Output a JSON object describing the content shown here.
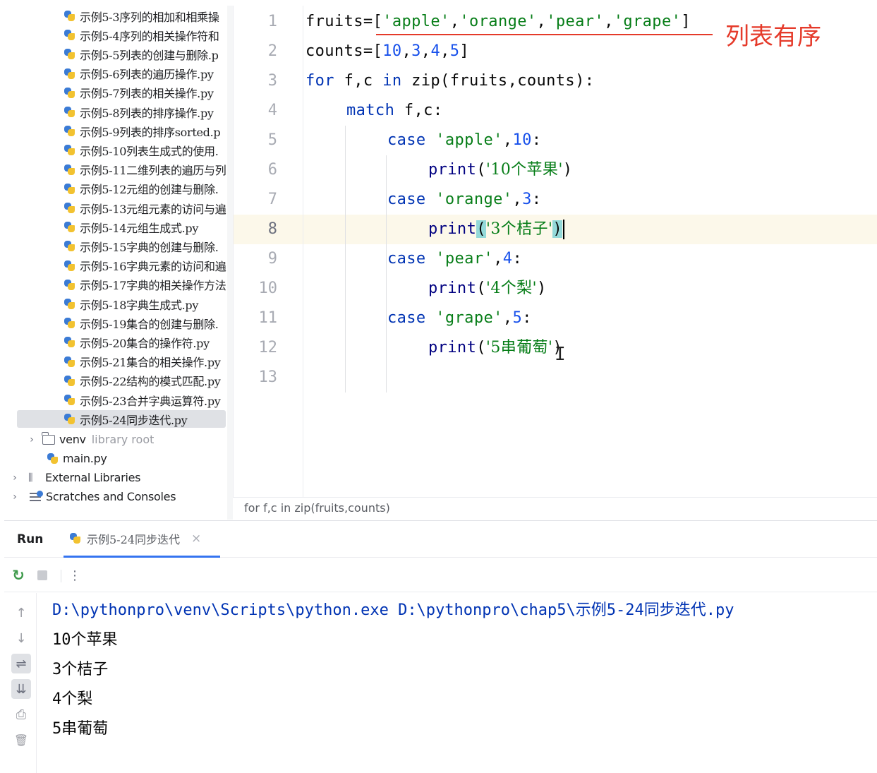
{
  "project_tree": {
    "files": [
      "示例5-3序列的相加和相乘操",
      "示例5-4序列的相关操作符和",
      "示例5-5列表的创建与删除.p",
      "示例5-6列表的遍历操作.py",
      "示例5-7列表的相关操作.py",
      "示例5-8列表的排序操作.py",
      "示例5-9列表的排序sorted.p",
      "示例5-10列表生成式的使用.",
      "示例5-11二维列表的遍历与列",
      "示例5-12元组的创建与删除.",
      "示例5-13元组元素的访问与遍",
      "示例5-14元组生成式.py",
      "示例5-15字典的创建与删除.",
      "示例5-16字典元素的访问和遍",
      "示例5-17字典的相关操作方法",
      "示例5-18字典生成式.py",
      "示例5-19集合的创建与删除.",
      "示例5-20集合的操作符.py",
      "示例5-21集合的相关操作.py",
      "示例5-22结构的模式匹配.py",
      "示例5-23合并字典运算符.py",
      "示例5-24同步迭代.py"
    ],
    "selected_index": 21,
    "venv_label": "venv",
    "venv_hint": "library root",
    "main_file": "main.py",
    "external_libraries": "External Libraries",
    "scratches": "Scratches and Consoles"
  },
  "editor": {
    "line_numbers": [
      "1",
      "2",
      "3",
      "4",
      "5",
      "6",
      "7",
      "8",
      "9",
      "10",
      "11",
      "12",
      "13"
    ],
    "current_line": 8,
    "breadcrumb": "for f,c in zip(fruits,counts)",
    "annotation": "列表有序",
    "tokens": {
      "fruits_assign": "fruits=[",
      "apple": "'apple'",
      "orange": "'orange'",
      "pear": "'pear'",
      "grape": "'grape'",
      "comma": ",",
      "rbracket": "]",
      "counts_assign": "counts=[",
      "n10": "10",
      "n3": "3",
      "n4": "4",
      "n5": "5",
      "kw_for": "for",
      "for_vars": " f,c ",
      "kw_in": "in",
      "for_rest": " zip(fruits,counts):",
      "kw_match": "match",
      "match_rest": " f,c:",
      "kw_case": "case",
      "colon": ":",
      "print": "print",
      "lparen": "(",
      "rparen": ")",
      "s1": "'10个苹果'",
      "s2": "'3个桔子'",
      "s3": "'4个梨'",
      "s4": "'5串葡萄'",
      "ibeam": "I"
    }
  },
  "run": {
    "title": "Run",
    "tab_label": "示例5-24同步迭代",
    "tab_close": "×",
    "toolbar": {
      "rerun_icon": "↻",
      "more_icon": "⋮"
    },
    "side": {
      "up": "↑",
      "down": "↓",
      "wrap": "⇌",
      "scroll_end": "⇊",
      "print": "⎙",
      "trash": "🗑"
    },
    "console_lines": [
      "D:\\pythonpro\\venv\\Scripts\\python.exe D:\\pythonpro\\chap5\\示例5-24同步迭代.py",
      "10个苹果",
      "3个桔子",
      "4个梨",
      "5串葡萄"
    ]
  }
}
